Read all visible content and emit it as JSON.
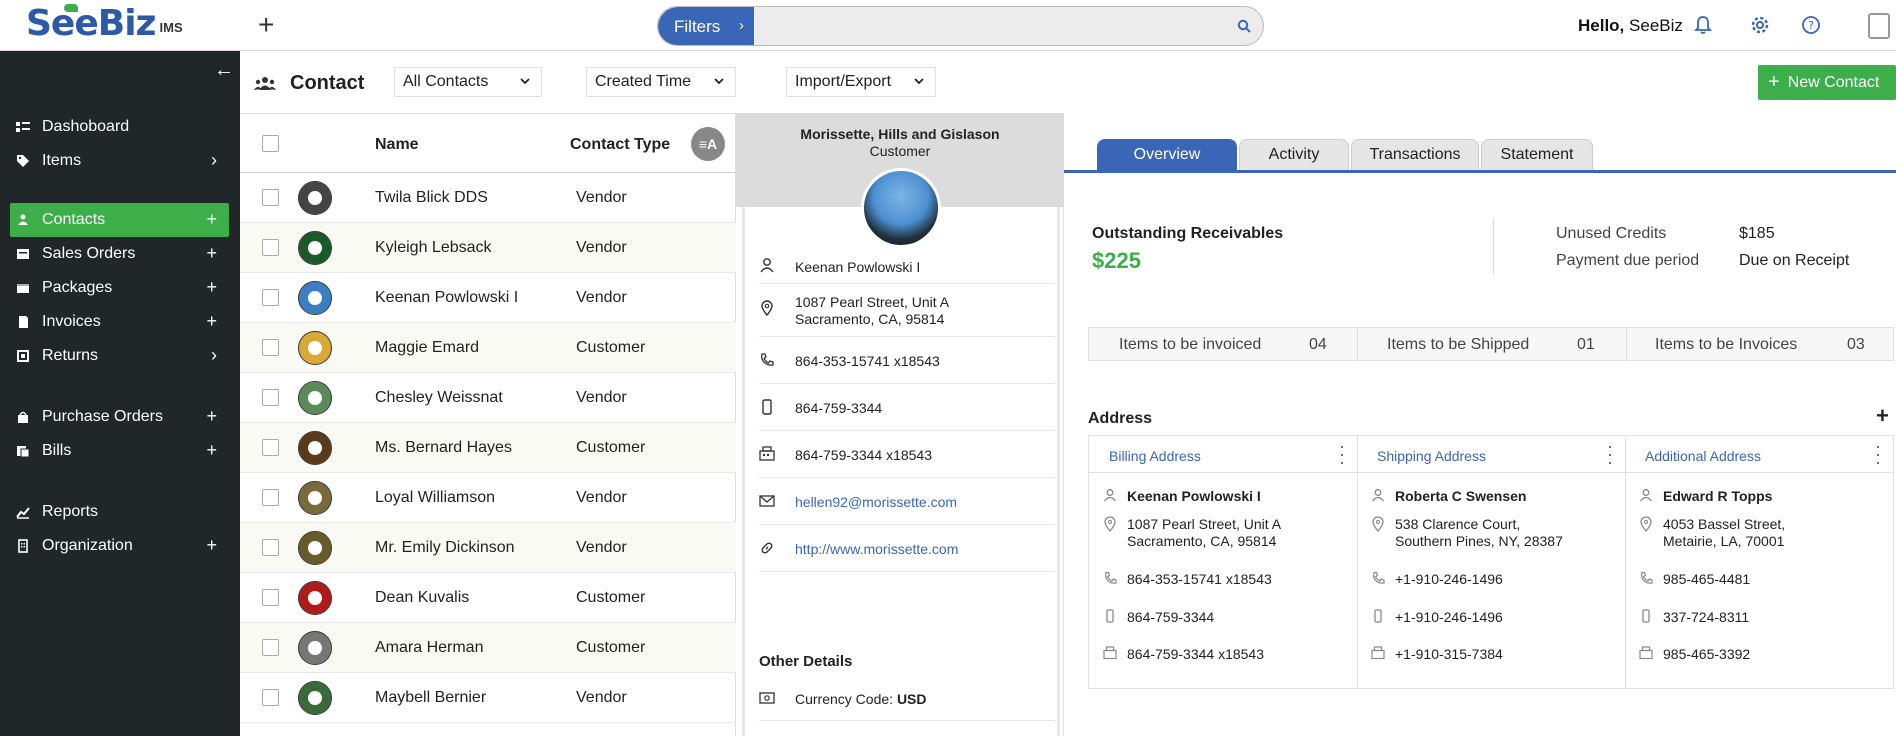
{
  "app": {
    "logo_see": "See",
    "logo_biz": "Biz",
    "logo_ims": "IMS",
    "accent": "#3cae4a",
    "brand": "#3a66b7"
  },
  "topbar": {
    "filters_label": "Filters",
    "search_placeholder": "",
    "hello_prefix": "Hello,",
    "hello_user": "SeeBiz"
  },
  "sidebar": {
    "items": [
      {
        "label": "Dashoboard",
        "icon": "dashboard-icon",
        "tail": ""
      },
      {
        "label": "Items",
        "icon": "tag-icon",
        "tail": "›"
      },
      {
        "label": "Contacts",
        "icon": "users-icon",
        "tail": "+"
      },
      {
        "label": "Sales Orders",
        "icon": "sales-orders-icon",
        "tail": "+"
      },
      {
        "label": "Packages",
        "icon": "package-icon",
        "tail": "+"
      },
      {
        "label": "Invoices",
        "icon": "invoice-icon",
        "tail": "+"
      },
      {
        "label": "Returns",
        "icon": "returns-icon",
        "tail": "›"
      },
      {
        "label": "Purchase Orders",
        "icon": "bag-icon",
        "tail": "+"
      },
      {
        "label": "Bills",
        "icon": "bills-icon",
        "tail": "+"
      },
      {
        "label": "Reports",
        "icon": "reports-icon",
        "tail": ""
      },
      {
        "label": "Organization",
        "icon": "organization-icon",
        "tail": "+"
      }
    ]
  },
  "header": {
    "title": "Contact",
    "filter_all": "All Contacts",
    "filter_sort": "Created Time",
    "import_export": "Import/Export",
    "new_contact": "New Contact"
  },
  "list": {
    "col_name": "Name",
    "col_type": "Contact Type",
    "sort_badge": "≡A",
    "rows": [
      {
        "name": "Twila Blick DDS",
        "type": "Vendor"
      },
      {
        "name": "Kyleigh Lebsack",
        "type": "Vendor"
      },
      {
        "name": "Keenan Powlowski I",
        "type": "Vendor"
      },
      {
        "name": "Maggie Emard",
        "type": "Customer"
      },
      {
        "name": "Chesley Weissnat",
        "type": "Vendor"
      },
      {
        "name": "Ms. Bernard Hayes",
        "type": "Customer"
      },
      {
        "name": "Loyal Williamson",
        "type": "Vendor"
      },
      {
        "name": "Mr. Emily Dickinson",
        "type": "Vendor"
      },
      {
        "name": "Dean Kuvalis",
        "type": "Customer"
      },
      {
        "name": "Amara Herman",
        "type": "Customer"
      },
      {
        "name": "Maybell Bernier",
        "type": "Vendor"
      }
    ]
  },
  "card": {
    "company": "Morissette, Hills and  Gislason",
    "role": "Customer",
    "person": "Keenan Powlowski I",
    "address_line1": "1087  Pearl Street, Unit A",
    "address_line2": "Sacramento, CA, 95814",
    "phone": "864-353-15741 x18543",
    "mobile": "864-759-3344",
    "fax": "864-759-3344 x18543",
    "email": "hellen92@morissette.com",
    "website": "http://www.morissette.com",
    "other_details": "Other Details",
    "currency_label": "Currency Code:",
    "currency_value": "USD"
  },
  "right": {
    "tabs": [
      "Overview",
      "Activity",
      "Transactions",
      "Statement"
    ],
    "outstanding_label": "Outstanding Receivables",
    "outstanding_value": "$225",
    "unused_credits_label": "Unused Credits",
    "unused_credits_value": "$185",
    "payment_due_label": "Payment due period",
    "payment_due_value": "Due on Receipt",
    "stats": [
      {
        "label": "Items to be invoiced",
        "value": "04"
      },
      {
        "label": "Items to be Shipped",
        "value": "01"
      },
      {
        "label": "Items to be Invoices",
        "value": "03"
      }
    ],
    "address_title": "Address",
    "addresses": [
      {
        "title": "Billing Address",
        "name": "Keenan Powlowski I",
        "line1": "1087  Pearl Street, Unit A",
        "line2": "Sacramento, CA, 95814",
        "phone": "864-353-15741 x18543",
        "mobile": "864-759-3344",
        "fax": "864-759-3344 x18543"
      },
      {
        "title": "Shipping Address",
        "name": "Roberta C Swensen",
        "line1": "538 Clarence Court,",
        "line2": "Southern Pines, NY, 28387",
        "phone": "+1-910-246-1496",
        "mobile": "+1-910-246-1496",
        "fax": "+1-910-315-7384"
      },
      {
        "title": "Additional Address",
        "name": "Edward R Topps",
        "line1": "4053  Bassel Street,",
        "line2": "Metairie, LA, 70001",
        "phone": "985-465-4481",
        "mobile": "337-724-8311",
        "fax": "985-465-3392"
      }
    ]
  }
}
